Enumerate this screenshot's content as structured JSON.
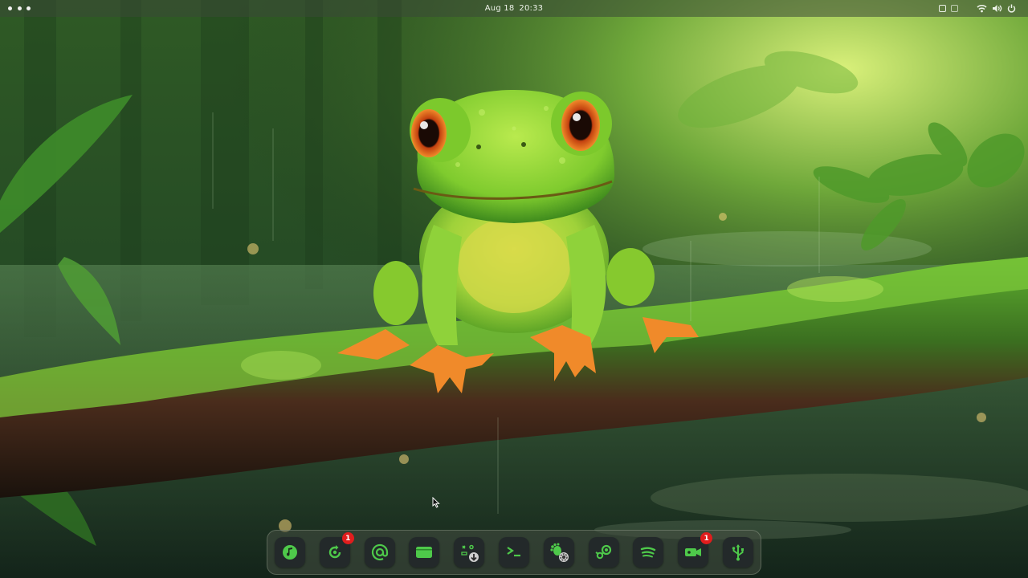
{
  "topbar": {
    "date": "Aug 18",
    "time": "20:33",
    "activities_icon": "dots-icon",
    "tray": [
      "screen-icon",
      "clipboard-icon",
      "wifi-icon",
      "volume-icon",
      "power-icon"
    ]
  },
  "dock": {
    "items": [
      {
        "icon": "audio-player-icon",
        "badge": ""
      },
      {
        "icon": "update-icon",
        "badge": "1"
      },
      {
        "icon": "email-at-icon",
        "badge": ""
      },
      {
        "icon": "window-icon",
        "badge": ""
      },
      {
        "icon": "gamepad-download-icon",
        "badge": ""
      },
      {
        "icon": "terminal-icon",
        "badge": ""
      },
      {
        "icon": "gnome-settings-icon",
        "badge": ""
      },
      {
        "icon": "steam-icon",
        "badge": ""
      },
      {
        "icon": "spotify-icon",
        "badge": ""
      },
      {
        "icon": "video-camera-icon",
        "badge": "1"
      },
      {
        "icon": "usb-icon",
        "badge": ""
      }
    ]
  },
  "colors": {
    "accent": "#4ec94a",
    "badge": "#e11d1d",
    "dock_icon_bg": "#23292a"
  }
}
